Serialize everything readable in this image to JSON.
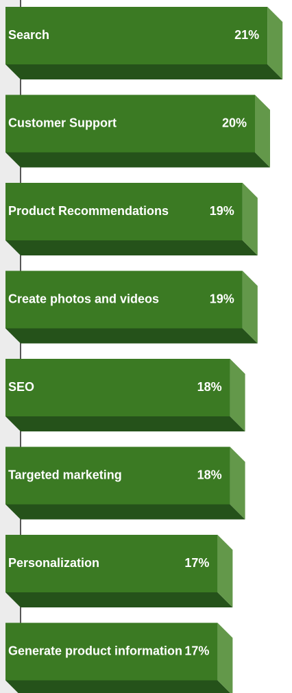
{
  "chart_data": {
    "type": "bar",
    "orientation": "horizontal",
    "style": "3d",
    "categories": [
      "Search",
      "Customer Support",
      "Product Recommendations",
      "Create photos and videos",
      "SEO",
      "Targeted marketing",
      "Personalization",
      "Generate product information"
    ],
    "values": [
      21,
      20,
      19,
      19,
      18,
      18,
      17,
      17
    ],
    "value_labels": [
      "21%",
      "20%",
      "19%",
      "19%",
      "18%",
      "18%",
      "17%",
      "17%"
    ],
    "unit": "%",
    "title": "",
    "xlabel": "",
    "ylabel": "",
    "colors": {
      "front": "#3b7a23",
      "side": "#63984a",
      "bottom": "#25521a",
      "axis": "#222222",
      "axis_panel": "#ececec"
    }
  }
}
